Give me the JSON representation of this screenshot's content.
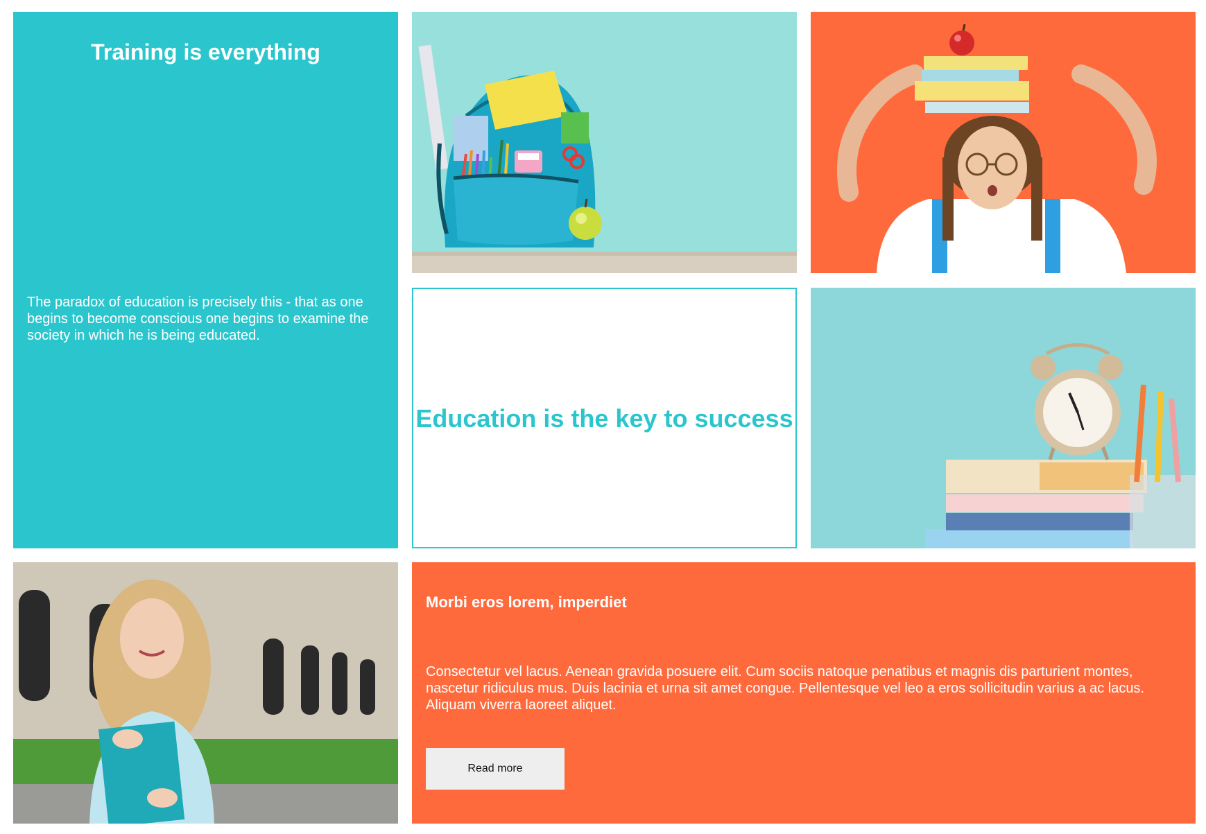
{
  "tiles": {
    "training": {
      "title": "Training is everything",
      "body": "The paradox of education is precisely this - that as one begins to become conscious one begins to examine the society in which he is being educated."
    },
    "quote": {
      "title": "Education is the key to success"
    },
    "feature": {
      "title": "Morbi eros lorem, imperdiet",
      "body": "Consectetur vel lacus. Aenean gravida posuere elit. Cum sociis natoque penatibus et magnis dis parturient montes, nascetur ridiculus mus. Duis lacinia et urna sit amet congue. Pellentesque vel leo a eros sollicitudin varius a ac lacus. Aliquam viverra laoreet aliquet.",
      "button_label": "Read more"
    }
  },
  "images": {
    "backpack": "backpack-photo",
    "girl_books": "girl-with-books-photo",
    "clock": "alarm-clock-books-photo",
    "student": "student-with-folder-photo"
  },
  "colors": {
    "teal": "#2bc6cd",
    "orange": "#ff6a3d",
    "button_bg": "#eeeeee"
  }
}
